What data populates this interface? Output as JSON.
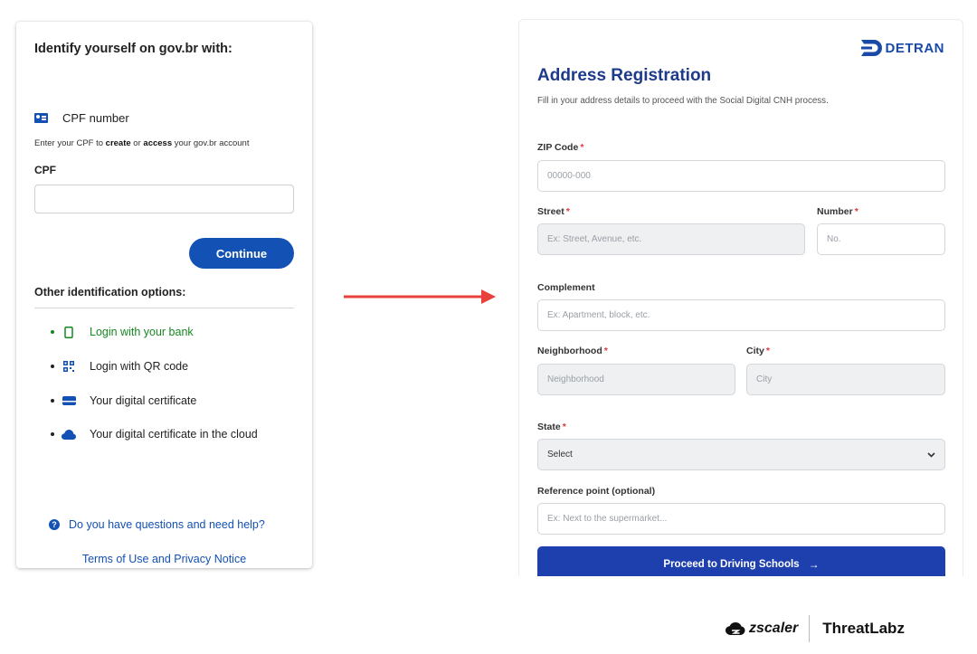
{
  "govbr": {
    "title": "Identify yourself on gov.br with:",
    "cpf_option_label": "CPF number",
    "hint_prefix": "Enter your CPF to ",
    "hint_create": "create",
    "hint_or": " or ",
    "hint_access": "access",
    "hint_suffix": " your gov.br account",
    "cpf_field_label": "CPF",
    "cpf_value": "",
    "continue_label": "Continue",
    "other_options_title": "Other identification options:",
    "options": [
      {
        "label": "Login with your bank",
        "icon": "smartphone-icon",
        "color": "#168821"
      },
      {
        "label": "Login with QR code",
        "icon": "qr-code-icon"
      },
      {
        "label": "Your digital certificate",
        "icon": "certificate-card-icon"
      },
      {
        "label": "Your digital certificate in the cloud",
        "icon": "cloud-icon"
      }
    ],
    "help_label": "Do you have questions and need help?",
    "terms_label": "Terms of Use and Privacy Notice",
    "accent_color": "#1351b4"
  },
  "detran": {
    "logo_text": "DETRAN",
    "title": "Address Registration",
    "subtitle": "Fill in your address details to proceed with the Social Digital CNH process.",
    "required_mark": "*",
    "fields": {
      "zip": {
        "label": "ZIP Code",
        "placeholder": "00000-000",
        "required": true
      },
      "street": {
        "label": "Street",
        "placeholder": "Ex: Street, Avenue, etc.",
        "required": true
      },
      "number": {
        "label": "Number",
        "placeholder": "No.",
        "required": true
      },
      "complement": {
        "label": "Complement",
        "placeholder": "Ex: Apartment, block, etc.",
        "required": false
      },
      "neighborhood": {
        "label": "Neighborhood",
        "placeholder": "Neighborhood",
        "required": true
      },
      "city": {
        "label": "City",
        "placeholder": "City",
        "required": true
      },
      "state": {
        "label": "State",
        "selected": "Select",
        "required": true
      },
      "reference": {
        "label": "Reference point (optional)",
        "placeholder": "Ex: Next to the supermarket...",
        "required": false
      }
    },
    "proceed_label": "Proceed to Driving Schools",
    "proceed_arrow": "→",
    "accent_color": "#1e40af"
  },
  "footer": {
    "zscaler_text": "zscaler",
    "threatlabz_text": "ThreatLabz"
  },
  "arrow_color": "#e8413c"
}
